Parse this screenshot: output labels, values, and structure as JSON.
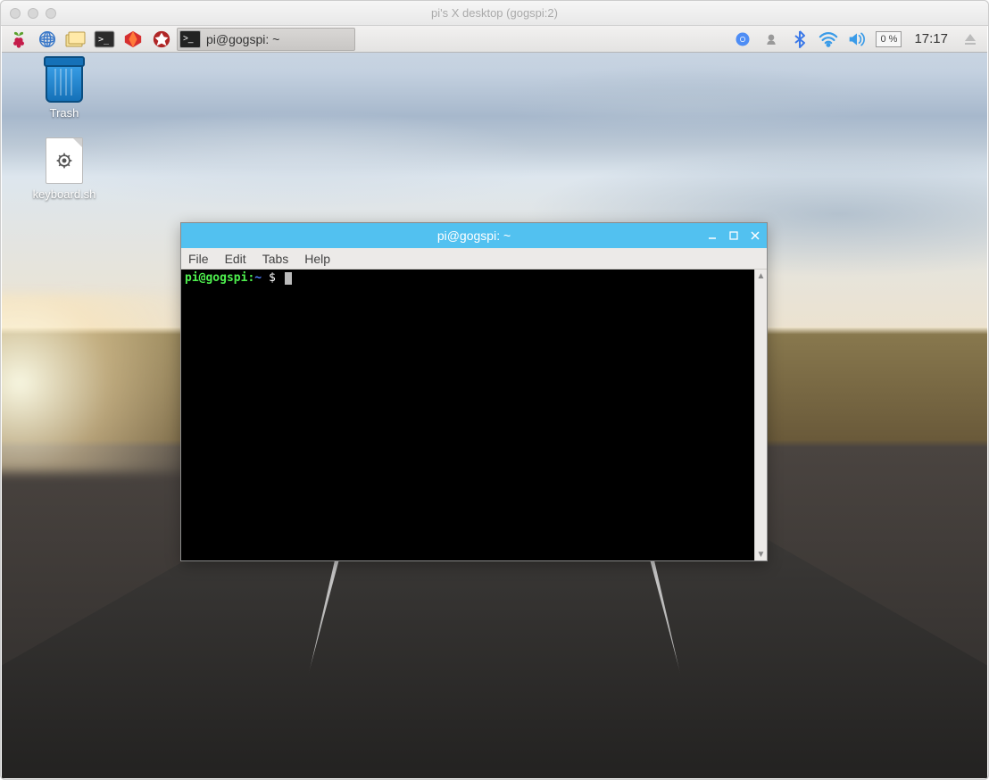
{
  "mac": {
    "title": "pi's X desktop (gogspi:2)"
  },
  "taskbar": {
    "app_button_label": "pi@gogspi: ~",
    "tray": {
      "cpu": "0 %",
      "clock": "17:17"
    }
  },
  "desktop": {
    "trash_label": "Trash",
    "keyboard_label": "keyboard.sh"
  },
  "terminal": {
    "title": "pi@gogspi: ~",
    "menus": [
      "File",
      "Edit",
      "Tabs",
      "Help"
    ],
    "prompt": {
      "userhost": "pi@gogspi",
      "sep": ":",
      "path": "~",
      "dollar": "$"
    }
  }
}
